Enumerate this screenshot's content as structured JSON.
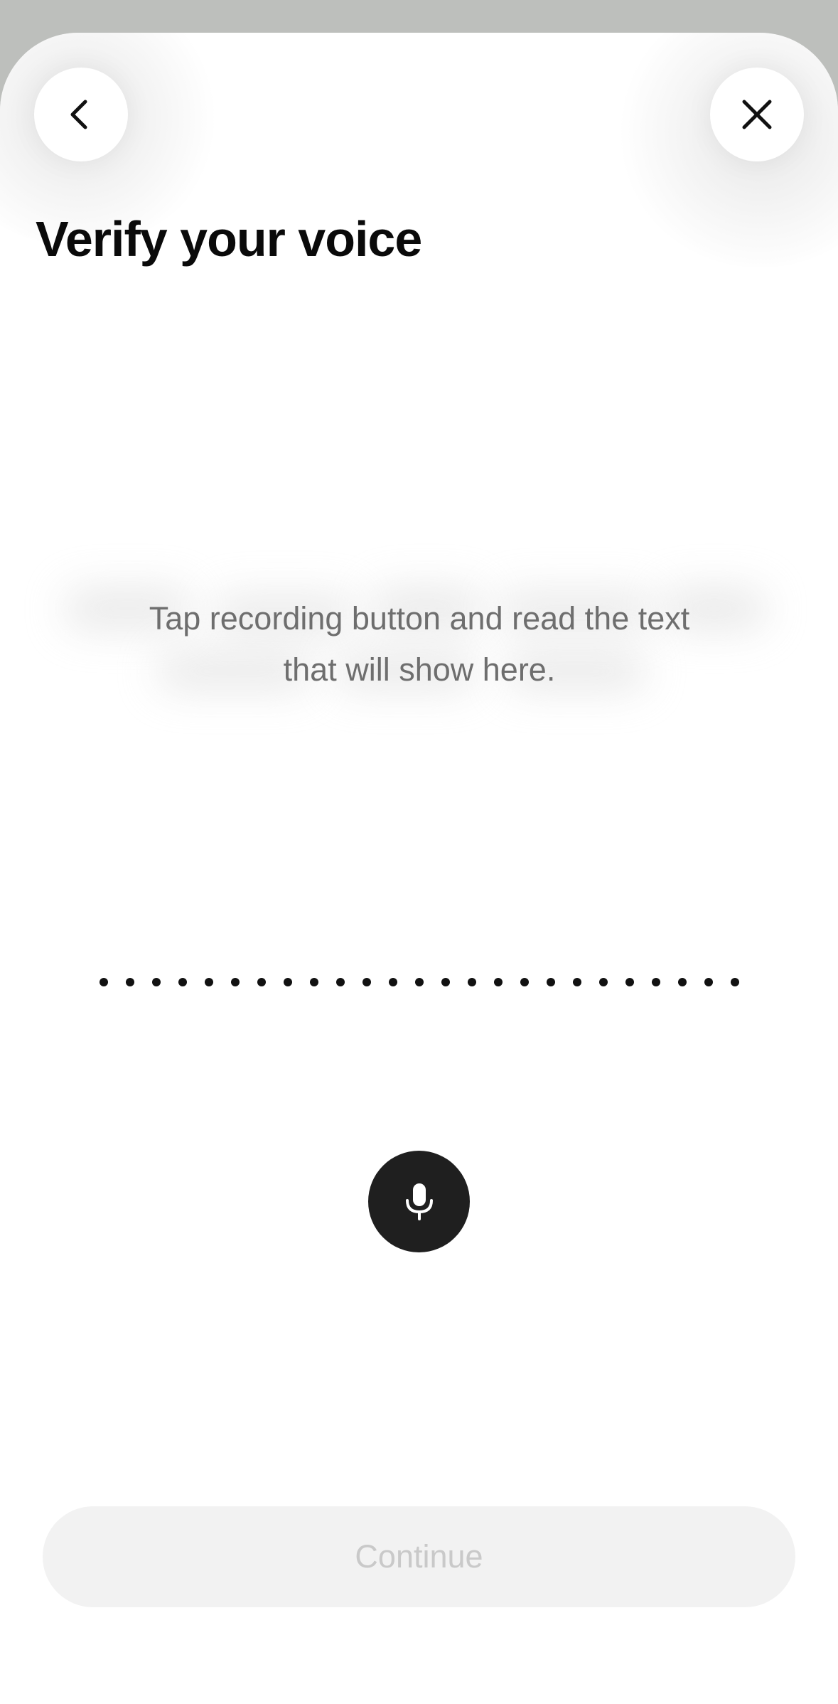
{
  "header": {
    "back_icon": "chevron-left-icon",
    "close_icon": "close-icon",
    "title": "Verify your voice"
  },
  "prompt": {
    "line1": "Tap recording button and read the text",
    "line2": "that will show here."
  },
  "waveform": {
    "dot_count": 25
  },
  "record": {
    "icon": "microphone-icon"
  },
  "footer": {
    "continue_label": "Continue",
    "continue_enabled": false
  },
  "colors": {
    "background_top": "#bdbfbc",
    "sheet": "#ffffff",
    "title": "#0a0a0a",
    "prompt_text": "#6e6e6e",
    "mic_button": "#1f1f1f",
    "continue_bg_disabled": "#f2f2f2",
    "continue_text_disabled": "#c9c9c9"
  }
}
